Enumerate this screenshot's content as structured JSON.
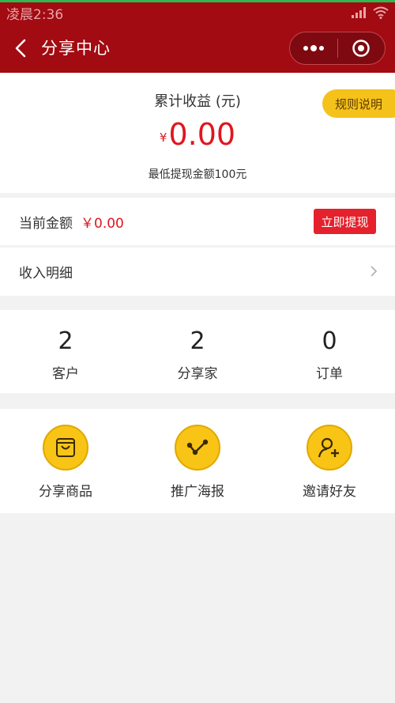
{
  "status_bar": {
    "time": "凌晨2:36"
  },
  "nav": {
    "title": "分享中心"
  },
  "earnings": {
    "title": "累计收益 (元)",
    "currency": "¥",
    "amount": "0.00",
    "min_withdraw": "最低提现金额100元",
    "rules_label": "规则说明"
  },
  "balance": {
    "label": "当前金额",
    "value": "￥0.00",
    "withdraw_label": "立即提现"
  },
  "detail": {
    "label": "收入明细"
  },
  "stats": [
    {
      "value": "2",
      "label": "客户"
    },
    {
      "value": "2",
      "label": "分享家"
    },
    {
      "value": "0",
      "label": "订单"
    }
  ],
  "actions": [
    {
      "label": "分享商品",
      "icon": "shopping-bag-icon"
    },
    {
      "label": "推广海报",
      "icon": "share-nodes-icon"
    },
    {
      "label": "邀请好友",
      "icon": "add-user-icon"
    }
  ],
  "colors": {
    "header": "#a20b12",
    "accent_red": "#e0161f",
    "accent_yellow": "#f5c21c"
  }
}
